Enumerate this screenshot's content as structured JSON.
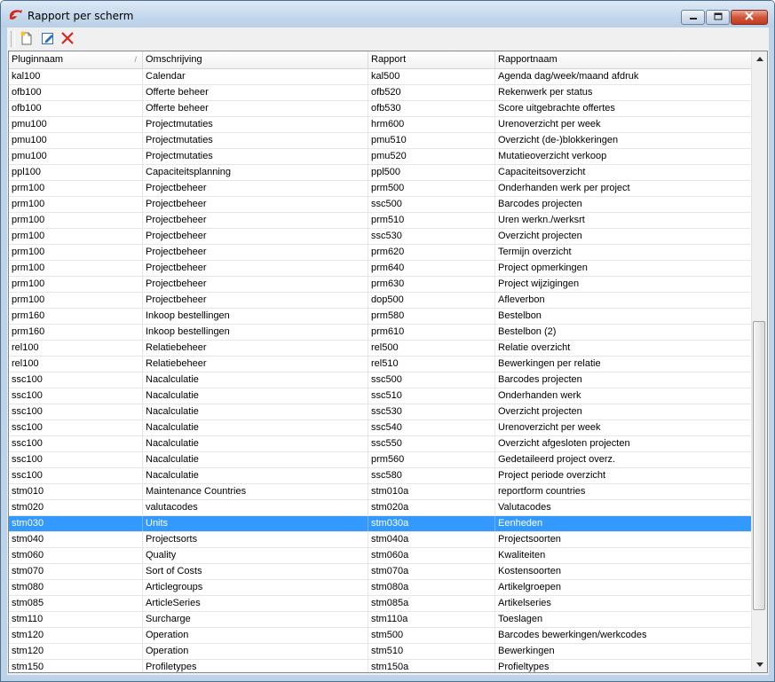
{
  "window": {
    "title": "Rapport per scherm"
  },
  "icons": {
    "app": "app-logo-icon",
    "minimize": "minimize-icon",
    "maximize": "maximize-icon",
    "close": "close-icon",
    "new": "new-document-icon",
    "edit": "edit-icon",
    "delete": "delete-icon",
    "scroll_up": "scroll-up-icon",
    "scroll_down": "scroll-down-icon"
  },
  "colors": {
    "selection": "#3399ff",
    "title_close": "#c23a1e",
    "delete_red": "#d9251d"
  },
  "grid": {
    "columns": [
      "Pluginnaam",
      "Omschrijving",
      "Rapport",
      "Rapportnaam"
    ],
    "sort_indicator": "/",
    "selected_index": 28,
    "rows": [
      [
        "kal100",
        "Calendar",
        "kal500",
        "Agenda dag/week/maand afdruk"
      ],
      [
        "ofb100",
        "Offerte beheer",
        "ofb520",
        "Rekenwerk per status"
      ],
      [
        "ofb100",
        "Offerte beheer",
        "ofb530",
        "Score uitgebrachte offertes"
      ],
      [
        "pmu100",
        "Projectmutaties",
        "hrm600",
        "Urenoverzicht per week"
      ],
      [
        "pmu100",
        "Projectmutaties",
        "pmu510",
        "Overzicht (de-)blokkeringen"
      ],
      [
        "pmu100",
        "Projectmutaties",
        "pmu520",
        "Mutatieoverzicht verkoop"
      ],
      [
        "ppl100",
        "Capaciteitsplanning",
        "ppl500",
        "Capaciteitsoverzicht"
      ],
      [
        "prm100",
        "Projectbeheer",
        "prm500",
        "Onderhanden werk per project"
      ],
      [
        "prm100",
        "Projectbeheer",
        "ssc500",
        "Barcodes projecten"
      ],
      [
        "prm100",
        "Projectbeheer",
        "prm510",
        "Uren werkn./werksrt"
      ],
      [
        "prm100",
        "Projectbeheer",
        "ssc530",
        "Overzicht projecten"
      ],
      [
        "prm100",
        "Projectbeheer",
        "prm620",
        "Termijn overzicht"
      ],
      [
        "prm100",
        "Projectbeheer",
        "prm640",
        "Project opmerkingen"
      ],
      [
        "prm100",
        "Projectbeheer",
        "prm630",
        "Project wijzigingen"
      ],
      [
        "prm100",
        "Projectbeheer",
        "dop500",
        "Afleverbon"
      ],
      [
        "prm160",
        "Inkoop bestellingen",
        "prm580",
        "Bestelbon"
      ],
      [
        "prm160",
        "Inkoop bestellingen",
        "prm610",
        "Bestelbon (2)"
      ],
      [
        "rel100",
        "Relatiebeheer",
        "rel500",
        "Relatie overzicht"
      ],
      [
        "rel100",
        "Relatiebeheer",
        "rel510",
        "Bewerkingen per relatie"
      ],
      [
        "ssc100",
        "Nacalculatie",
        "ssc500",
        "Barcodes projecten"
      ],
      [
        "ssc100",
        "Nacalculatie",
        "ssc510",
        "Onderhanden werk"
      ],
      [
        "ssc100",
        "Nacalculatie",
        "ssc530",
        "Overzicht projecten"
      ],
      [
        "ssc100",
        "Nacalculatie",
        "ssc540",
        "Urenoverzicht per week"
      ],
      [
        "ssc100",
        "Nacalculatie",
        "ssc550",
        "Overzicht afgesloten projecten"
      ],
      [
        "ssc100",
        "Nacalculatie",
        "prm560",
        "Gedetaileerd project overz."
      ],
      [
        "ssc100",
        "Nacalculatie",
        "ssc580",
        "Project periode overzicht"
      ],
      [
        "stm010",
        "Maintenance Countries",
        "stm010a",
        "reportform countries"
      ],
      [
        "stm020",
        "valutacodes",
        "stm020a",
        "Valutacodes"
      ],
      [
        "stm030",
        "Units",
        "stm030a",
        "Eenheden"
      ],
      [
        "stm040",
        "Projectsorts",
        "stm040a",
        "Projectsoorten"
      ],
      [
        "stm060",
        "Quality",
        "stm060a",
        "Kwaliteiten"
      ],
      [
        "stm070",
        "Sort of Costs",
        "stm070a",
        "Kostensoorten"
      ],
      [
        "stm080",
        "Articlegroups",
        "stm080a",
        "Artikelgroepen"
      ],
      [
        "stm085",
        "ArticleSeries",
        "stm085a",
        "Artikelseries"
      ],
      [
        "stm110",
        "Surcharge",
        "stm110a",
        "Toeslagen"
      ],
      [
        "stm120",
        "Operation",
        "stm500",
        "Barcodes bewerkingen/werkcodes"
      ],
      [
        "stm120",
        "Operation",
        "stm510",
        "Bewerkingen"
      ],
      [
        "stm150",
        "Profiletypes",
        "stm150a",
        "Profieltypes"
      ]
    ]
  }
}
